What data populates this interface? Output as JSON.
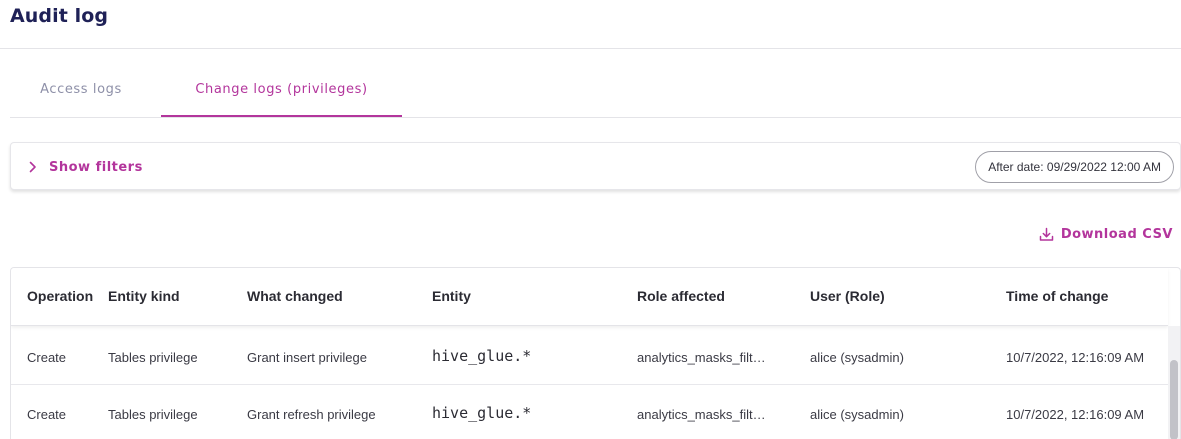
{
  "page": {
    "title": "Audit log"
  },
  "tabs": [
    {
      "label": "Access logs",
      "active": false
    },
    {
      "label": "Change logs (privileges)",
      "active": true
    }
  ],
  "filters": {
    "toggle_label": "Show filters",
    "toggle_icon": "chevron-right-icon",
    "after_date_label": "After date: 09/29/2022 12:00 AM"
  },
  "actions": {
    "download_label": "Download CSV",
    "download_icon": "download-icon"
  },
  "table": {
    "columns": [
      "Operation",
      "Entity kind",
      "What changed",
      "Entity",
      "Role affected",
      "User (Role)",
      "Time of change"
    ],
    "rows": [
      [
        "Create",
        "Tables privilege",
        "Grant insert privilege",
        "hive_glue.*",
        "analytics_masks_filt…",
        "alice (sysadmin)",
        "10/7/2022, 12:16:09 AM"
      ],
      [
        "Create",
        "Tables privilege",
        "Grant refresh privilege",
        "hive_glue.*",
        "analytics_masks_filt…",
        "alice (sysadmin)",
        "10/7/2022, 12:16:09 AM"
      ]
    ]
  },
  "colors": {
    "accent": "#b3359c",
    "title": "#1f2157",
    "inactive_tab": "#8e90a8"
  }
}
